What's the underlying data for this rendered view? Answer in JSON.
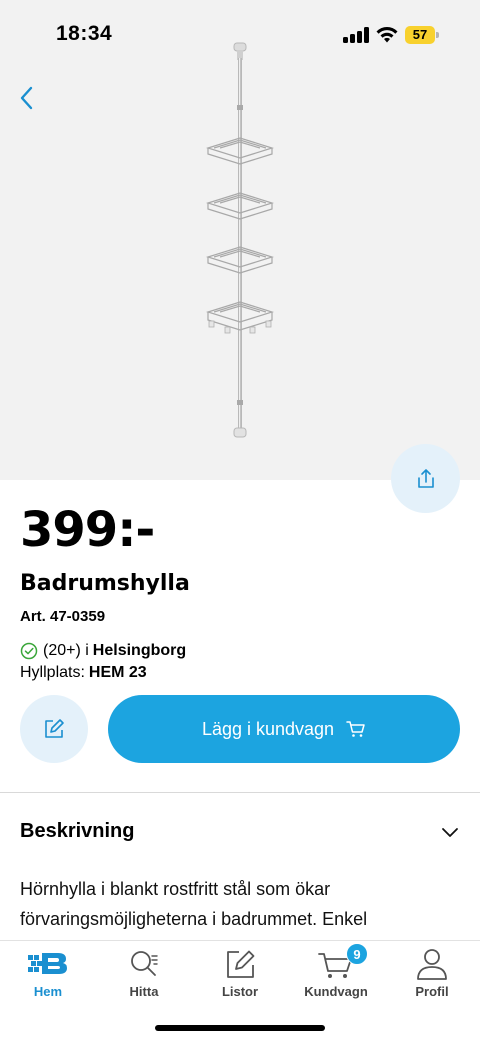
{
  "status_bar": {
    "time": "18:34",
    "battery": "57",
    "signal_icon": "cellular-signal-icon",
    "wifi_icon": "wifi-icon"
  },
  "product": {
    "price": "399:-",
    "title": "Badrumshylla",
    "article": "Art. 47-0359",
    "stock_count": "(20+) i",
    "stock_store": "Helsingborg",
    "shelf_label": "Hyllplats:",
    "shelf_code": "HEM 23",
    "add_to_cart_label": "Lägg i kundvagn"
  },
  "description": {
    "heading": "Beskrivning",
    "text": "Hörnhylla i blankt rostfritt stål som ökar förvaringsmöjligheterna i badrummet. Enkel"
  },
  "bottom_nav": {
    "items": [
      {
        "label": "Hem",
        "icon": "home-logo-icon"
      },
      {
        "label": "Hitta",
        "icon": "search-list-icon"
      },
      {
        "label": "Listor",
        "icon": "edit-list-icon"
      },
      {
        "label": "Kundvagn",
        "icon": "cart-icon",
        "badge": "9"
      },
      {
        "label": "Profil",
        "icon": "profile-icon"
      }
    ]
  },
  "colors": {
    "accent": "#1ca4e0",
    "accent_light": "#e4f1fa",
    "active_nav": "#1a8fd0",
    "image_bg": "#f2f2f2",
    "stock_ok": "#3aa63a",
    "battery": "#f8d12e"
  }
}
